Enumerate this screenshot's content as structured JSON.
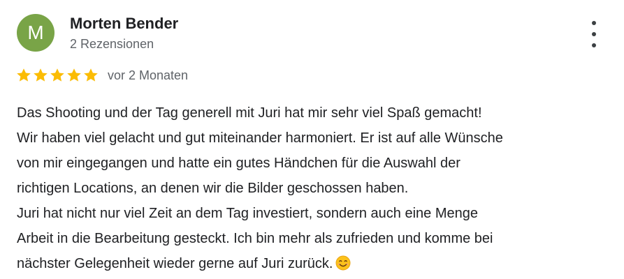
{
  "review": {
    "author": {
      "initial": "M",
      "name": "Morten Bender",
      "review_count": "2 Rezensionen",
      "avatar_color": "#79a447"
    },
    "rating": {
      "stars": 5,
      "max_stars": 5,
      "star_color": "#fbbc04"
    },
    "date": "vor 2 Monaten",
    "menu_icon": "more-vert-icon",
    "lines": [
      "Das Shooting und der Tag generell mit Juri hat mir sehr viel Spaß gemacht!",
      "Wir haben viel gelacht und gut miteinander harmoniert. Er ist auf alle Wünsche",
      "von mir eingegangen und hatte ein gutes Händchen für die Auswahl der",
      "richtigen Locations, an denen wir die Bilder geschossen haben.",
      "Juri hat nicht nur viel Zeit an dem Tag investiert, sondern auch eine Menge",
      "Arbeit in die Bearbeitung gesteckt. Ich bin mehr als zufrieden und komme bei",
      "nächster Gelegenheit wieder gerne auf Juri zurück."
    ],
    "end_emoji_icon": "smiling-face-emoji-icon"
  }
}
